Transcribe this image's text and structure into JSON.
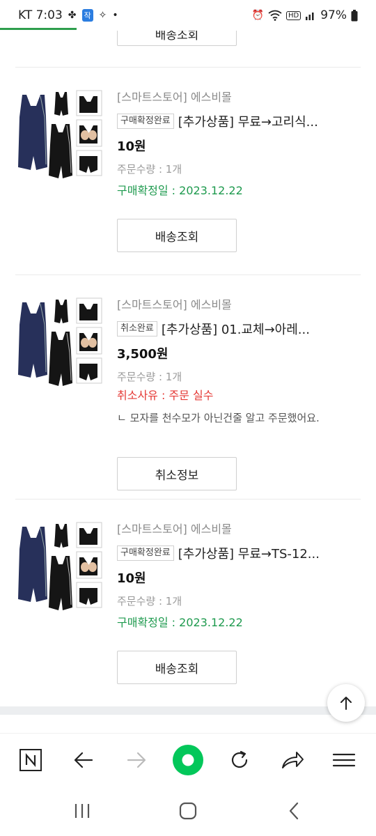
{
  "status_bar": {
    "carrier_time": "KT 7:03",
    "chat_badge": "작",
    "battery": "97%",
    "hd_badge": "HD"
  },
  "top_partial_button": "배송조회",
  "orders": [
    {
      "store": "[스마트스토어] 에스비몰",
      "status_tag": "구매확정완료",
      "product": "[추가상품] 무료→고리식...",
      "price": "10원",
      "qty": "주문수량 : 1개",
      "confirm_date": "구매확정일 : 2023.12.22",
      "action": "배송조회"
    },
    {
      "store": "[스마트스토어] 에스비몰",
      "status_tag": "취소완료",
      "product": "[추가상품] 01.교체→아레...",
      "price": "3,500원",
      "qty": "주문수량 : 1개",
      "cancel_reason": "취소사유 : 주문 실수",
      "cancel_detail": "ㄴ 모자를 천수모가 아닌건줄 알고 주문했어요.",
      "action": "취소정보"
    },
    {
      "store": "[스마트스토어] 에스비몰",
      "status_tag": "구매확정완료",
      "product": "[추가상품] 무료→TS-12...",
      "price": "10원",
      "qty": "주문수량 : 1개",
      "confirm_date": "구매확정일 : 2023.12.22",
      "action": "배송조회"
    }
  ],
  "toolbar_icons": [
    "naver-n-icon",
    "back-arrow-icon",
    "forward-arrow-icon",
    "green-home-icon",
    "refresh-icon",
    "share-icon",
    "menu-icon"
  ],
  "colors": {
    "green": "#1e9a4e",
    "red": "#e53935",
    "naver_green": "#03c75a"
  }
}
